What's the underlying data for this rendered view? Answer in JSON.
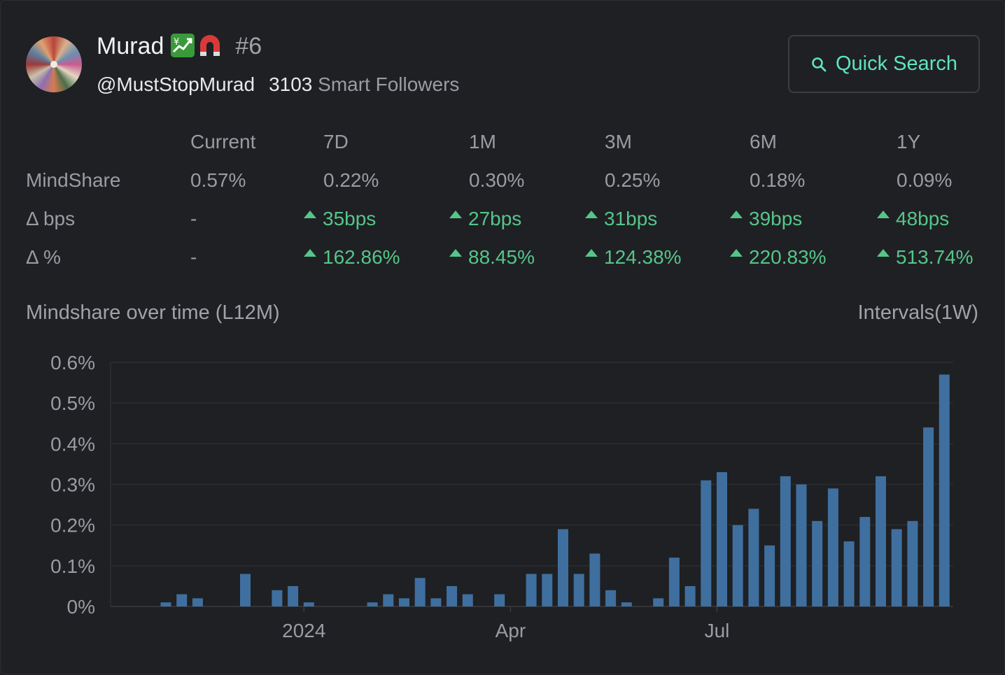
{
  "profile": {
    "name": "Murad",
    "rank": "#6",
    "handle": "@MustStopMurad",
    "smart_followers_count": "3103",
    "smart_followers_label": "Smart Followers",
    "emojis": [
      "chart-increasing-with-yen-icon",
      "magnet-icon"
    ]
  },
  "search": {
    "label": "Quick Search",
    "icon": "search-icon"
  },
  "stats": {
    "columns": [
      "Current",
      "7D",
      "1M",
      "3M",
      "6M",
      "1Y"
    ],
    "rows": [
      {
        "label": "MindShare",
        "values": [
          "0.57%",
          "0.22%",
          "0.30%",
          "0.25%",
          "0.18%",
          "0.09%"
        ],
        "trend": [
          null,
          null,
          null,
          null,
          null,
          null
        ]
      },
      {
        "label": "Δ bps",
        "values": [
          "-",
          "35bps",
          "27bps",
          "31bps",
          "39bps",
          "48bps"
        ],
        "trend": [
          null,
          "up",
          "up",
          "up",
          "up",
          "up"
        ]
      },
      {
        "label": "Δ %",
        "values": [
          "-",
          "162.86%",
          "88.45%",
          "124.38%",
          "220.83%",
          "513.74%"
        ],
        "trend": [
          null,
          "up",
          "up",
          "up",
          "up",
          "up"
        ]
      }
    ]
  },
  "chart_section": {
    "title": "Mindshare over time (L12M)",
    "interval": "Intervals(1W)"
  },
  "colors": {
    "bar": "#3f6f9f",
    "up": "#55c58a",
    "accent": "#5de3c0"
  },
  "chart_data": {
    "type": "bar",
    "title": "Mindshare over time (L12M)",
    "y_tick_labels": [
      "0%",
      "0.1%",
      "0.2%",
      "0.3%",
      "0.4%",
      "0.5%",
      "0.6%"
    ],
    "x_tick_labels": [
      "2024",
      "Apr",
      "Jul"
    ],
    "ylim": [
      0,
      0.6
    ],
    "grid": true,
    "values": [
      0.01,
      0.03,
      0.02,
      0,
      0,
      0.08,
      0,
      0.04,
      0.05,
      0.01,
      0,
      0,
      0,
      0.01,
      0.03,
      0.02,
      0.07,
      0.02,
      0.05,
      0.03,
      0,
      0.03,
      0,
      0.08,
      0.08,
      0.19,
      0.08,
      0.13,
      0.04,
      0.01,
      0,
      0.02,
      0.12,
      0.05,
      0.31,
      0.33,
      0.2,
      0.24,
      0.15,
      0.32,
      0.3,
      0.21,
      0.29,
      0.16,
      0.22,
      0.32,
      0.19,
      0.21,
      0.44,
      0.57
    ]
  }
}
